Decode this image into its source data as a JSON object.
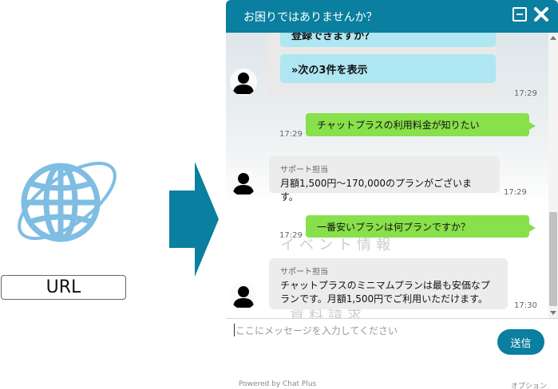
{
  "url_label": "URL",
  "chat": {
    "title": "お困りではありませんか？",
    "messages": {
      "partial_option": "登録できますか？",
      "next_option": "»次の3件を表示",
      "time1": "17:29",
      "user1": "チャットプラスの利用料金が知りたい",
      "time2": "17:29",
      "bot1_sender": "サポート担当",
      "bot1_text": "月額1,500円～170,000のプランがございます。",
      "time3": "17:29",
      "user2": "一番安いプランは何プランですか？",
      "time4": "17:29",
      "bot2_sender": "サポート担当",
      "bot2_text_line1": "チャットプラスのミニマムプランは最も安価なプ",
      "bot2_text_line2": "ランです。月額1,500円でご利用いただけます。",
      "time5": "17:30"
    },
    "input_placeholder": "ここにメッセージを入力してください",
    "send_label": "送信",
    "powered_by": "Powered by Chat Plus",
    "option_label": "オプション"
  },
  "colors": {
    "header": "#0a7fa0",
    "user_bubble": "#88e04a",
    "option_button": "#aee6f2",
    "arrow": "#0a7fa0",
    "globe": "#7fbde2"
  },
  "icons": [
    "globe-icon",
    "right-arrow-icon",
    "minimize-icon",
    "close-icon",
    "user-avatar-icon"
  ]
}
